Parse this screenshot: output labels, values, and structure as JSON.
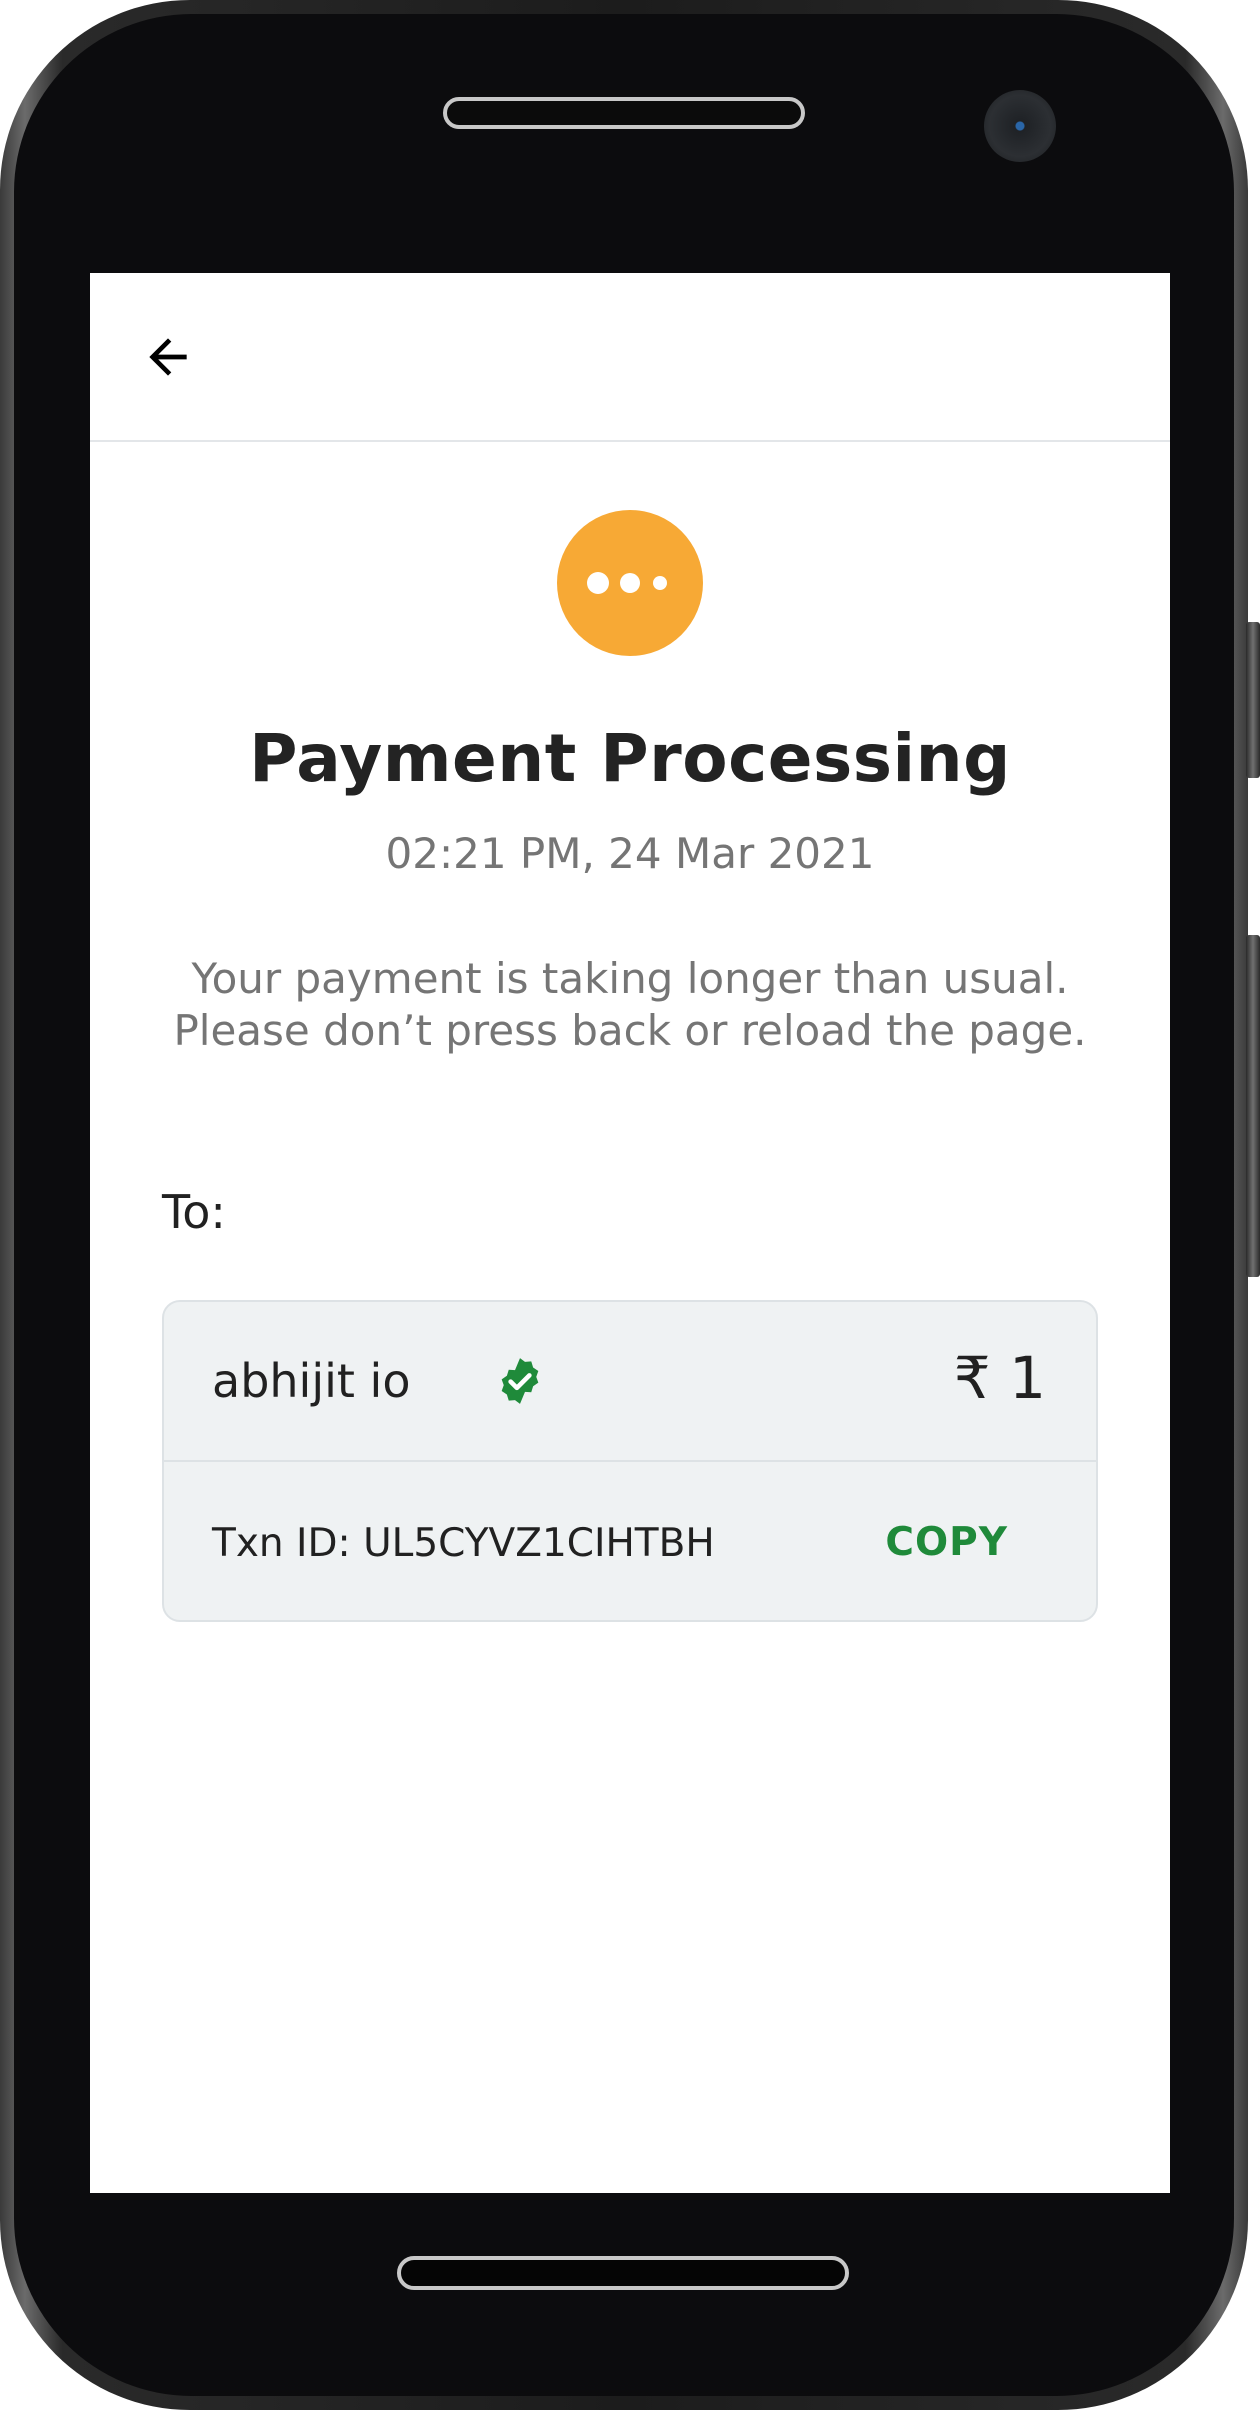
{
  "header": {
    "back_icon": "arrow-left-icon"
  },
  "status": {
    "icon": "pending-dots-icon",
    "color": "#f7a935",
    "title": "Payment Processing",
    "timestamp": "02:21 PM, 24 Mar 2021",
    "message_line1": "Your payment is taking longer than usual.",
    "message_line2": "Please don’t press back or reload the page."
  },
  "recipient": {
    "label": "To:",
    "name": "abhijit io",
    "verified_icon": "verified-badge-icon",
    "verified_color": "#1f8a3a",
    "amount": "₹ 1",
    "txn_id": "Txn ID: UL5CYVZ1CIHTBH",
    "copy_label": "COPY",
    "copy_color": "#1f8a3a"
  }
}
